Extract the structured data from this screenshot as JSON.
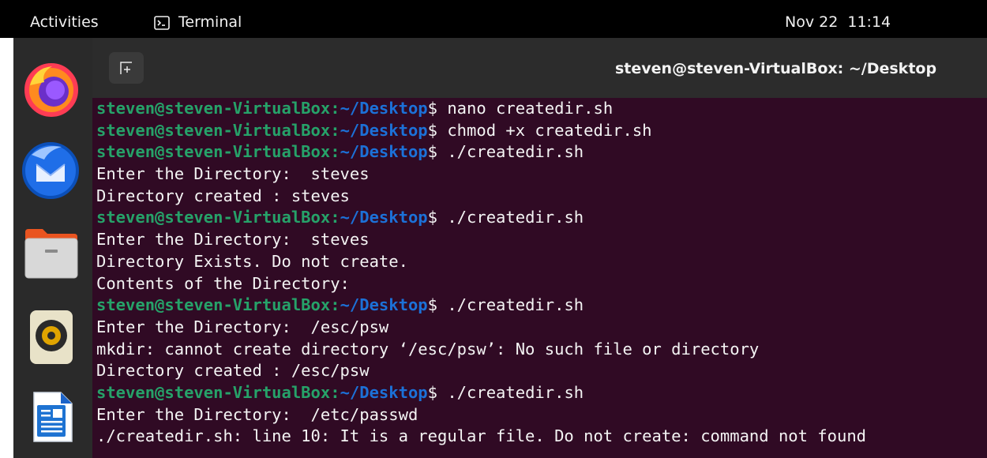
{
  "topbar": {
    "activities": "Activities",
    "app_label": "Terminal",
    "clock": "Nov 22  11:14"
  },
  "dock": {
    "items": [
      {
        "name": "Firefox",
        "icon": "firefox-icon"
      },
      {
        "name": "Thunderbird",
        "icon": "thunderbird-icon"
      },
      {
        "name": "Files",
        "icon": "files-icon"
      },
      {
        "name": "Rhythmbox",
        "icon": "rhythmbox-icon"
      },
      {
        "name": "LibreOffice Writer",
        "icon": "libreoffice-writer-icon"
      }
    ]
  },
  "window": {
    "title": "steven@steven-VirtualBox: ~/Desktop",
    "new_tab_icon": "new-tab-icon"
  },
  "terminal": {
    "lines": [
      {
        "type": "prompt",
        "user": "steven@steven-VirtualBox",
        "sep": ":",
        "path": "~/Desktop",
        "sym": "$",
        "cmd": " nano createdir.sh"
      },
      {
        "type": "prompt",
        "user": "steven@steven-VirtualBox",
        "sep": ":",
        "path": "~/Desktop",
        "sym": "$",
        "cmd": " chmod +x createdir.sh"
      },
      {
        "type": "prompt",
        "user": "steven@steven-VirtualBox",
        "sep": ":",
        "path": "~/Desktop",
        "sym": "$",
        "cmd": " ./createdir.sh"
      },
      {
        "type": "output",
        "text": "Enter the Directory:  steves"
      },
      {
        "type": "output",
        "text": "Directory created : steves"
      },
      {
        "type": "prompt",
        "user": "steven@steven-VirtualBox",
        "sep": ":",
        "path": "~/Desktop",
        "sym": "$",
        "cmd": " ./createdir.sh"
      },
      {
        "type": "output",
        "text": "Enter the Directory:  steves"
      },
      {
        "type": "output",
        "text": "Directory Exists. Do not create."
      },
      {
        "type": "output",
        "text": "Contents of the Directory:"
      },
      {
        "type": "prompt",
        "user": "steven@steven-VirtualBox",
        "sep": ":",
        "path": "~/Desktop",
        "sym": "$",
        "cmd": " ./createdir.sh"
      },
      {
        "type": "output",
        "text": "Enter the Directory:  /esc/psw"
      },
      {
        "type": "output",
        "text": "mkdir: cannot create directory ‘/esc/psw’: No such file or directory"
      },
      {
        "type": "output",
        "text": "Directory created : /esc/psw"
      },
      {
        "type": "prompt",
        "user": "steven@steven-VirtualBox",
        "sep": ":",
        "path": "~/Desktop",
        "sym": "$",
        "cmd": " ./createdir.sh"
      },
      {
        "type": "output",
        "text": "Enter the Directory:  /etc/passwd"
      },
      {
        "type": "output",
        "text": "./createdir.sh: line 10: It is a regular file. Do not create: command not found"
      }
    ]
  },
  "colors": {
    "terminal_bg": "#300a24",
    "prompt_user": "#26a269",
    "prompt_path": "#1c71d8",
    "text": "#f4f4f4",
    "titlebar_bg": "#2c2c2c",
    "topbar_bg": "#000000",
    "dock_bg": "#2a2a2a"
  }
}
